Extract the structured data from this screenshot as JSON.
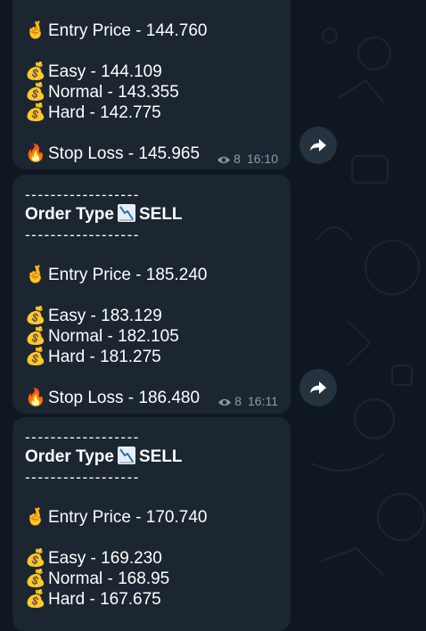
{
  "messages": [
    {
      "entry": "Entry Price - 144.760",
      "targets": [
        "Easy - 144.109",
        "Normal - 143.355",
        "Hard - 142.775"
      ],
      "stop": "Stop Loss - 145.965",
      "views": "8",
      "time": "16:10"
    },
    {
      "divider": "------------------",
      "order_prefix": "Order Type",
      "order_side": "SELL",
      "entry": "Entry Price - 185.240",
      "targets": [
        "Easy - 183.129",
        "Normal - 182.105",
        "Hard - 181.275"
      ],
      "stop": "Stop Loss - 186.480",
      "views": "8",
      "time": "16:11"
    },
    {
      "divider": "------------------",
      "order_prefix": "Order Type",
      "order_side": "SELL",
      "entry": "Entry Price - 170.740",
      "targets": [
        "Easy - 169.230",
        "Normal - 168.95",
        "Hard - 167.675"
      ]
    }
  ],
  "icons": {
    "entry": "crossed-fingers-icon",
    "target": "money-bag-icon",
    "stop": "fire-icon",
    "order": "chart-decreasing-icon",
    "views": "eye-icon",
    "share": "share-arrow-icon"
  }
}
